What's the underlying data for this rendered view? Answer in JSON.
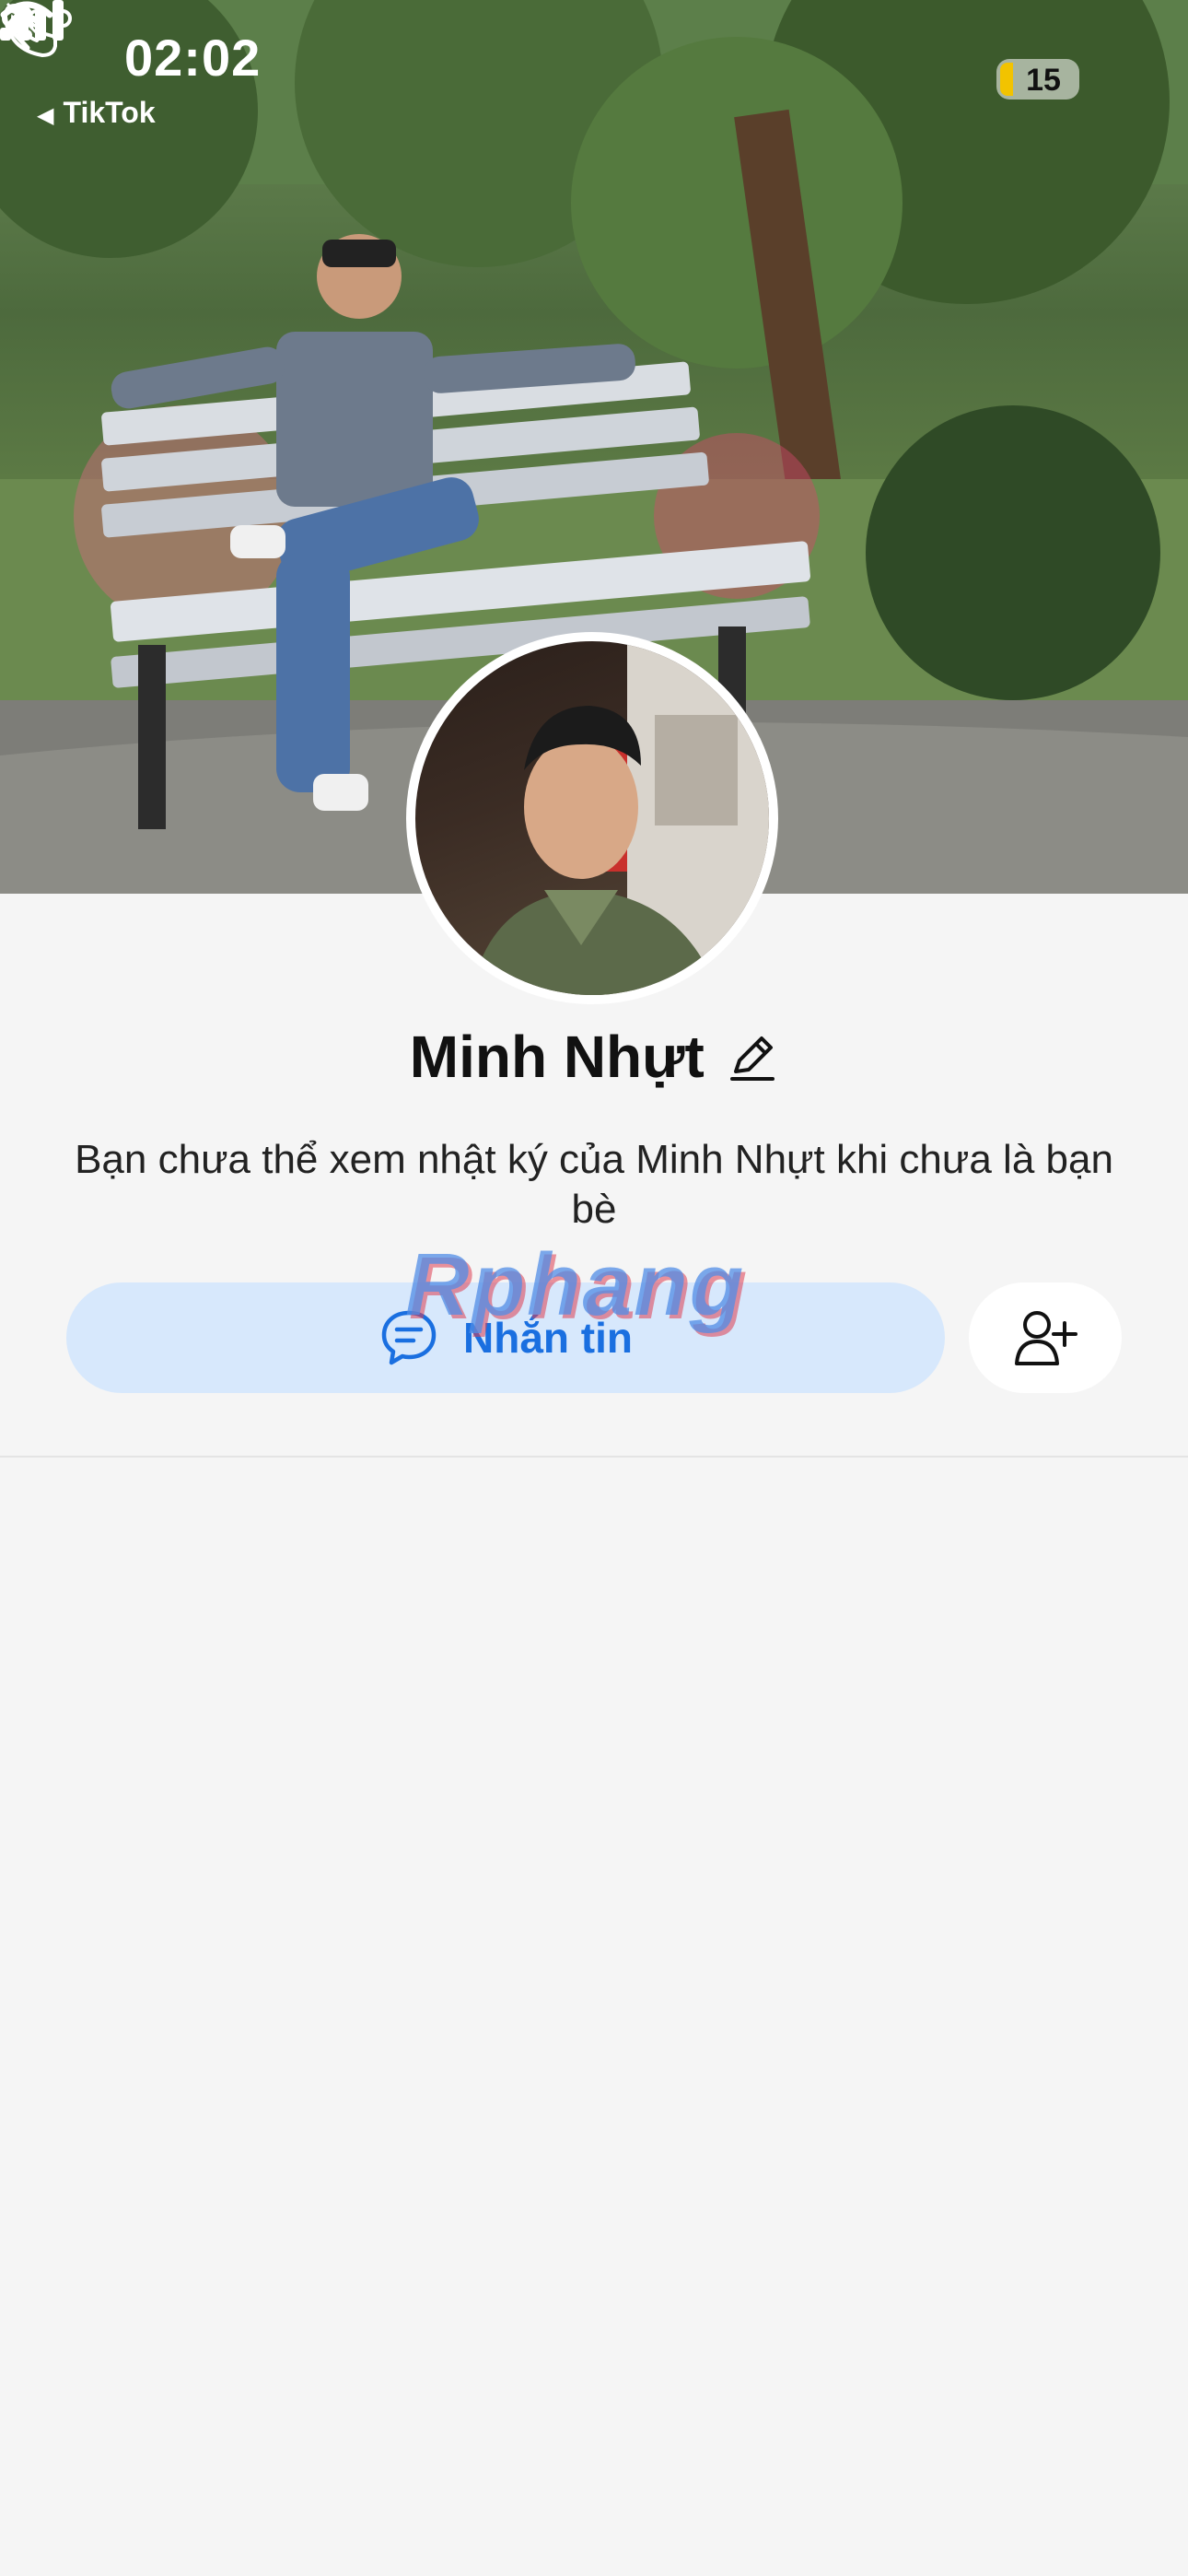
{
  "status_bar": {
    "time": "02:02",
    "back_app": "TikTok",
    "battery": "15",
    "icons": [
      "bell-slash-icon",
      "signal-icon",
      "wifi-icon",
      "battery-icon"
    ]
  },
  "header": {
    "icons": [
      "back-chevron-icon",
      "phone-icon",
      "more-icon"
    ]
  },
  "profile": {
    "name": "Minh Nhựt",
    "notice": "Bạn chưa thể xem nhật ký của Minh Nhựt khi chưa là bạn bè"
  },
  "actions": {
    "message_label": "Nhắn tin",
    "message_icon": "chat-bubble-icon",
    "add_friend_icon": "add-friend-icon"
  },
  "watermark": "Rphang",
  "colors": {
    "accent": "#1a6fe0",
    "message_button_bg": "#d7e8fc",
    "page_bg": "#f5f5f5"
  }
}
